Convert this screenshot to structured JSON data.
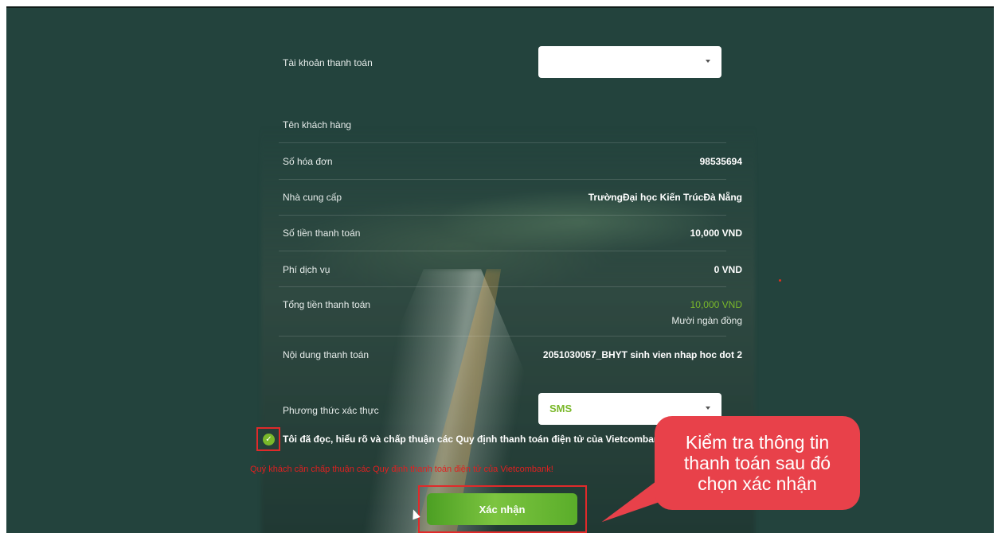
{
  "form": {
    "account_label": "Tài khoản thanh toán",
    "account_value": "",
    "customer_name_label": "Tên khách hàng",
    "customer_name_value": "",
    "invoice_label": "Số hóa đơn",
    "invoice_value": "98535694",
    "provider_label": "Nhà cung cấp",
    "provider_value": "TrườngĐại học Kiến TrúcĐà Nẵng",
    "amount_label": "Số tiền thanh toán",
    "amount_value": "10,000 VND",
    "fee_label": "Phí dịch vụ",
    "fee_value": "0 VND",
    "total_label": "Tổng tiền thanh toán",
    "total_value": "10,000 VND",
    "total_words": "Mười ngàn đồng",
    "content_label": "Nội dung thanh toán",
    "content_value": "2051030057_BHYT sinh vien nhap hoc dot 2",
    "auth_label": "Phương thức xác thực",
    "auth_value": "SMS",
    "agree_text": "Tôi đã đọc, hiểu rõ và chấp thuận các Quy định thanh toán điện tử của Vietcombank,",
    "warning_text": "Quý khách cần chấp thuận các Quy định thanh toán điện tử của Vietcombank!",
    "confirm_label": "Xác nhận"
  },
  "callout": {
    "lines": [
      "Kiểm tra thông tin",
      "thanh toán sau đó",
      "chọn xác nhận"
    ]
  },
  "colors": {
    "background": "#23433d",
    "accent_green": "#7ab82a",
    "highlight_red": "#e02a2a",
    "callout_red": "#e8414a"
  },
  "icons": {
    "checkbox": "check-circle-icon",
    "dropdown": "triangle-down-icon",
    "cursor": "mouse-pointer-icon"
  }
}
